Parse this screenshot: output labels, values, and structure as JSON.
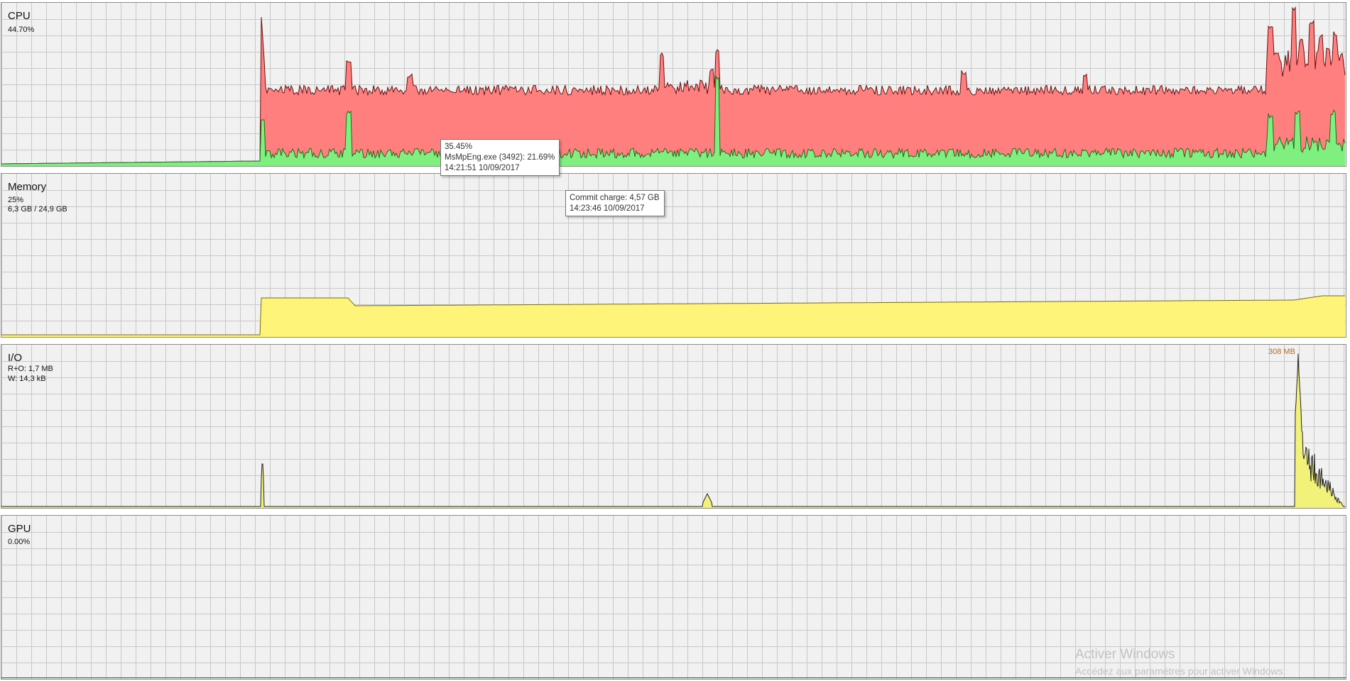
{
  "colors": {
    "panel_bg": "#f1f1f1",
    "grid": "#c8c8c8",
    "cpu_total_fill": "#ff7f7f",
    "cpu_total_line": "#6b1010",
    "cpu_proc_fill": "#7ff07f",
    "cpu_proc_line": "#1a6e1a",
    "memory_fill": "#fff47a",
    "memory_line": "#7a6d00",
    "io_fill": "#f2f27a",
    "io_line": "#222222"
  },
  "panels": {
    "cpu": {
      "title": "CPU",
      "value": "44.70%"
    },
    "memory": {
      "title": "Memory",
      "percent": "25%",
      "usage": "6,3 GB / 24,9 GB"
    },
    "io": {
      "title": "I/O",
      "read_other": "R+O: 1,7 MB",
      "write": "W: 14,3 kB",
      "peak_label": "308 MB"
    },
    "gpu": {
      "title": "GPU",
      "value": "0.00%"
    }
  },
  "tooltips": {
    "cpu": {
      "line1": "35.45%",
      "line2": "MsMpEng.exe (3492): 21.69%",
      "line3": "14:21:51 10/09/2017"
    },
    "memory": {
      "line1": "Commit charge: 4,57 GB",
      "line2": "14:23:46 10/09/2017"
    }
  },
  "watermark": {
    "title": "Activer Windows",
    "subtitle": "Accédez aux paramètres pour activer Windows."
  }
}
